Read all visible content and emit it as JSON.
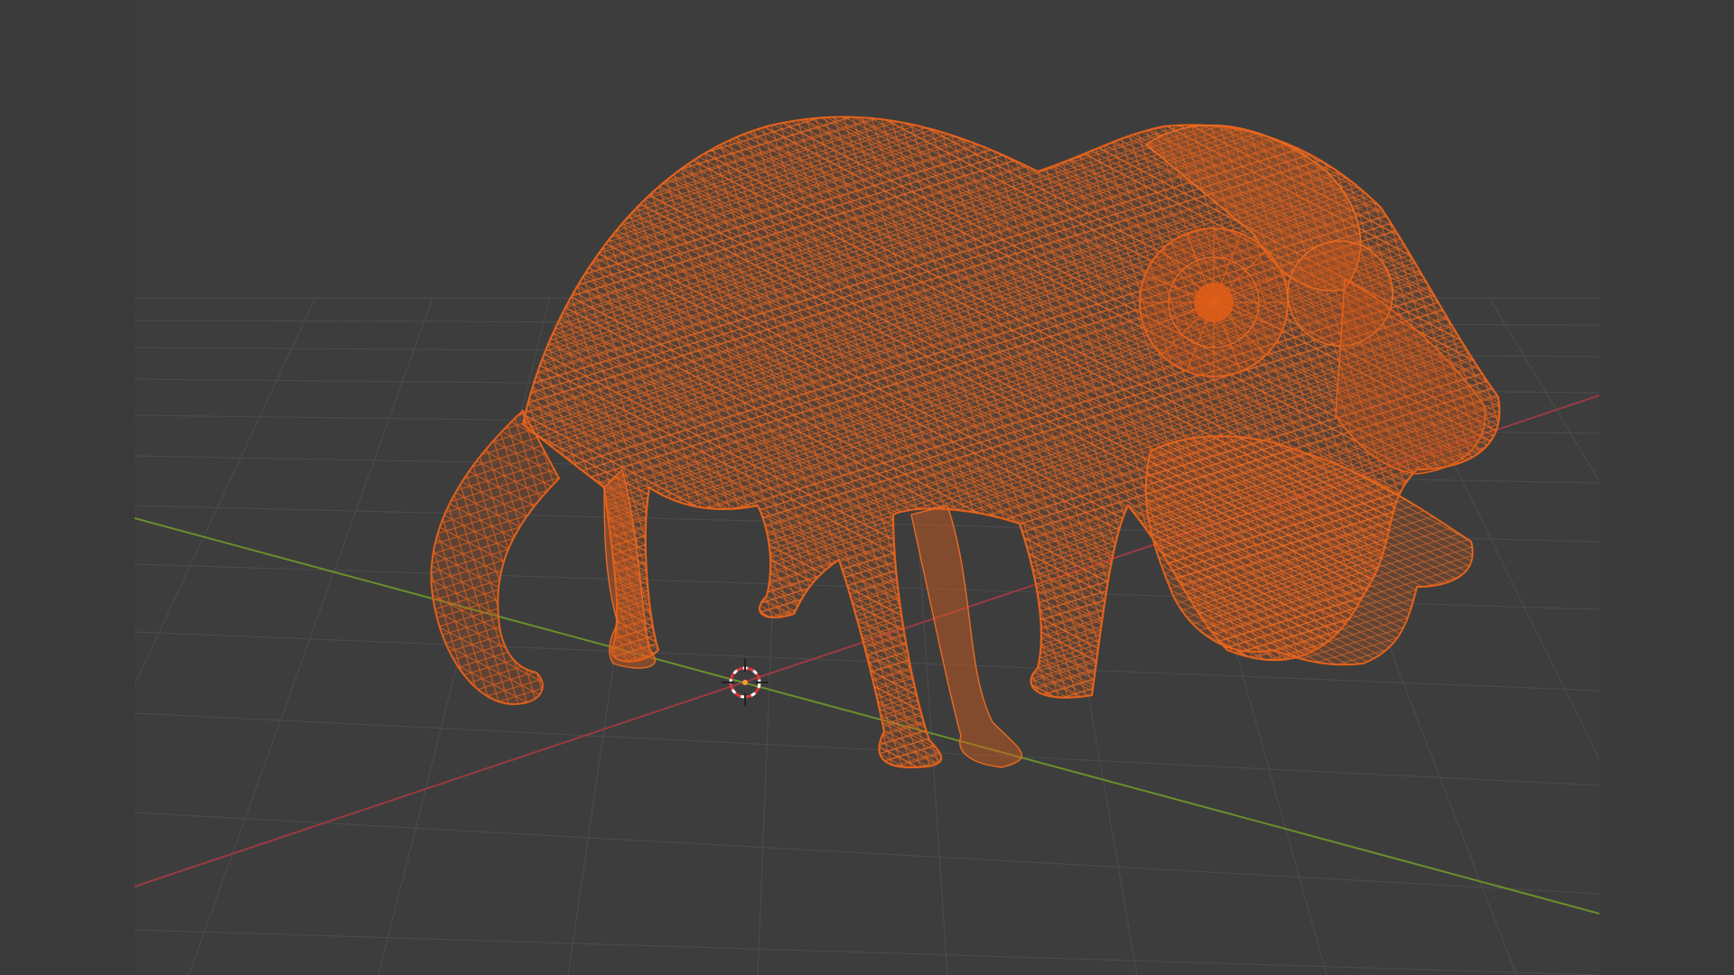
{
  "viewport": {
    "background_color": "#3d3d3d",
    "outer_background_color": "#3a3a3a",
    "grid_color": "#4a4a4a",
    "x_axis_color": "#9a3a44",
    "y_axis_color": "#6b8f2c",
    "view_mode": "wireframe",
    "selected_object": {
      "wire_color": "#e2601a",
      "fill_color": "#c4531a",
      "subject": "chameleon"
    },
    "icons": [
      "3d-cursor-icon"
    ]
  }
}
